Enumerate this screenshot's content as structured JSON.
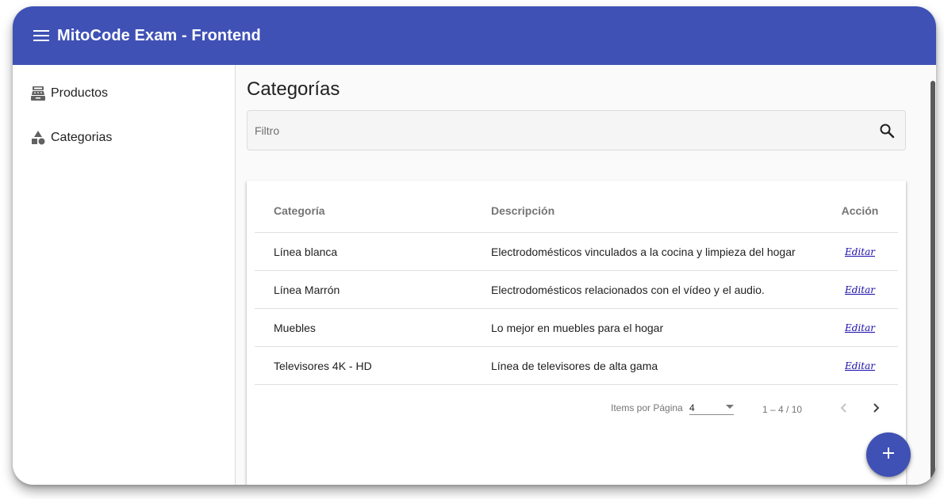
{
  "app": {
    "title": "MitoCode Exam - Frontend",
    "toolbar_color": "#3f51b5",
    "menu_icon": "menu-icon"
  },
  "sidebar": {
    "items": [
      {
        "label": "Productos",
        "icon": "cash-register-icon"
      },
      {
        "label": "Categorias",
        "icon": "shapes-icon"
      }
    ]
  },
  "page": {
    "title": "Categorías"
  },
  "search": {
    "placeholder": "Filtro",
    "value": "",
    "icon": "search-icon"
  },
  "table": {
    "columns": [
      "Categoría",
      "Descripción",
      "Acción"
    ],
    "rows": [
      {
        "categoria": "Línea blanca",
        "descripcion": "Electrodomésticos vinculados a la cocina y limpieza del hogar",
        "accion": "Editar"
      },
      {
        "categoria": "Línea Marrón",
        "descripcion": "Electrodomésticos relacionados con el vídeo y el audio.",
        "accion": "Editar"
      },
      {
        "categoria": "Muebles",
        "descripcion": "Lo mejor en muebles para el hogar",
        "accion": "Editar"
      },
      {
        "categoria": "Televisores 4K - HD",
        "descripcion": "Línea de televisores de alta gama",
        "accion": "Editar"
      }
    ]
  },
  "paginator": {
    "items_label": "Items por Página",
    "page_size": "4",
    "range": "1 – 4 / 10"
  },
  "fab": {
    "icon": "plus-icon",
    "color": "#3f51b5"
  }
}
